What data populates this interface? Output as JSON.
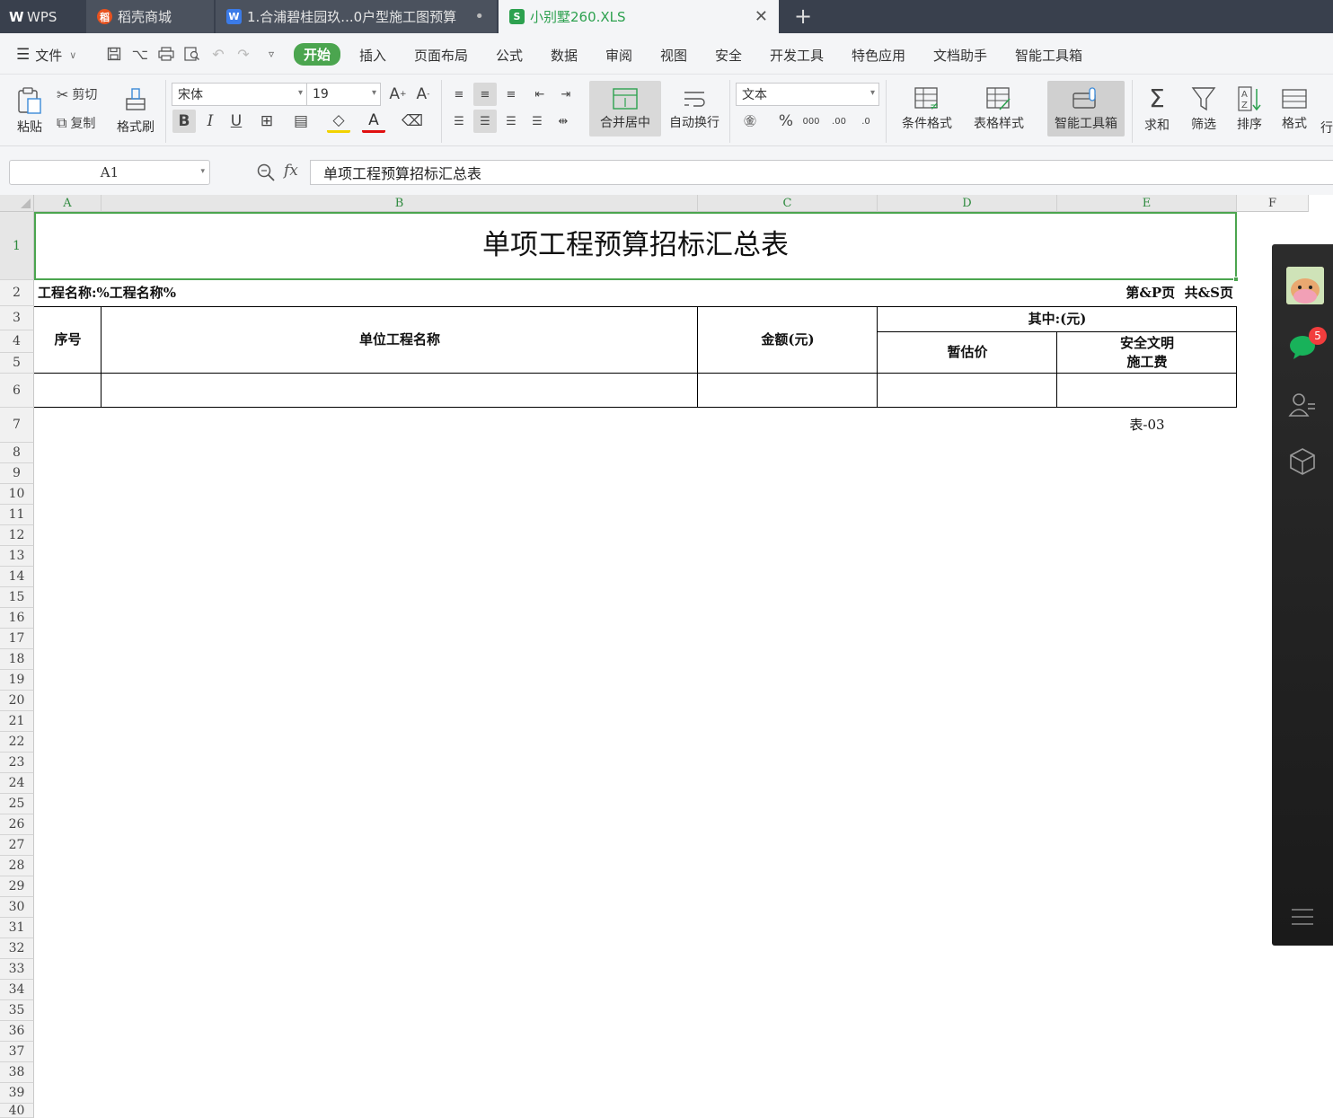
{
  "tabs": [
    {
      "label": "WPS",
      "icon": "wps-logo-icon"
    },
    {
      "label": "稻壳商城",
      "icon": "docer-icon"
    },
    {
      "label": "1.合浦碧桂园玖...0户型施工图预算",
      "icon": "writer-doc-icon"
    },
    {
      "label": "小别墅260.XLS",
      "icon": "spreadsheet-icon"
    }
  ],
  "menubar": {
    "file_label": "文件",
    "items": [
      "开始",
      "插入",
      "页面布局",
      "公式",
      "数据",
      "审阅",
      "视图",
      "安全",
      "开发工具",
      "特色应用",
      "文档助手",
      "智能工具箱"
    ],
    "active": "开始"
  },
  "ribbon": {
    "paste": "粘贴",
    "cut": "剪切",
    "copy": "复制",
    "format_painter": "格式刷",
    "font_name": "宋体",
    "font_size": "19",
    "merge_center": "合并居中",
    "wrap_text": "自动换行",
    "number_format": "文本",
    "conditional_format": "条件格式",
    "table_style": "表格样式",
    "smart_toolbox": "智能工具箱",
    "sum": "求和",
    "filter": "筛选",
    "sort": "排序",
    "format": "格式",
    "row_col": "行"
  },
  "formula_bar": {
    "name_box": "A1",
    "fx": "fx",
    "content": "单项工程预算招标汇总表"
  },
  "columns": [
    "A",
    "B",
    "C",
    "D",
    "E",
    "F"
  ],
  "rows": [
    "1",
    "2",
    "3",
    "4",
    "5",
    "6",
    "7",
    "8",
    "9",
    "10",
    "11",
    "12",
    "13",
    "14",
    "15",
    "16",
    "17",
    "18",
    "19",
    "20",
    "21",
    "22",
    "23",
    "24",
    "25",
    "26",
    "27",
    "28",
    "29",
    "30",
    "31",
    "32",
    "33",
    "34",
    "35",
    "36",
    "37",
    "38",
    "39",
    "40"
  ],
  "sheet": {
    "title": "单项工程预算招标汇总表",
    "project_name": "工程名称:%工程名称%",
    "page_info": "第&P页  共&S页",
    "headers": {
      "seq": "序号",
      "unit_name": "单位工程名称",
      "amount": "金额(元)",
      "of_which": "其中:(元)",
      "provisional": "暂估价",
      "safety_l1": "安全文明",
      "safety_l2": "施工费"
    },
    "footer": "表-03"
  },
  "side_panel": {
    "chat_badge": "5"
  },
  "colors": {
    "accent": "#4ba54f",
    "tabbar": "#39404d",
    "active_tab_text": "#2da14f",
    "selection": "#4ba54f"
  }
}
